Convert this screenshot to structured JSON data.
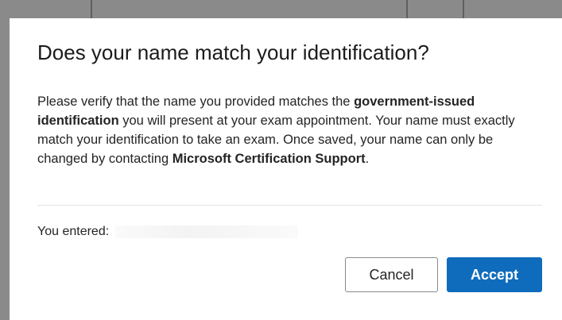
{
  "dialog": {
    "title": "Does your name match your identification?",
    "message_parts": {
      "p1": "Please verify that the name you provided matches the ",
      "b1": "government-issued identification",
      "p2": " you will present at your exam appointment. Your name must exactly match your identification to take an exam. Once saved, your name can only be changed by contacting ",
      "b2": "Microsoft Certification Support",
      "p3": "."
    },
    "entered_label": "You entered:",
    "buttons": {
      "cancel": "Cancel",
      "accept": "Accept"
    }
  },
  "colors": {
    "accent": "#0f6cbd",
    "overlay": "#8a8a8a"
  }
}
